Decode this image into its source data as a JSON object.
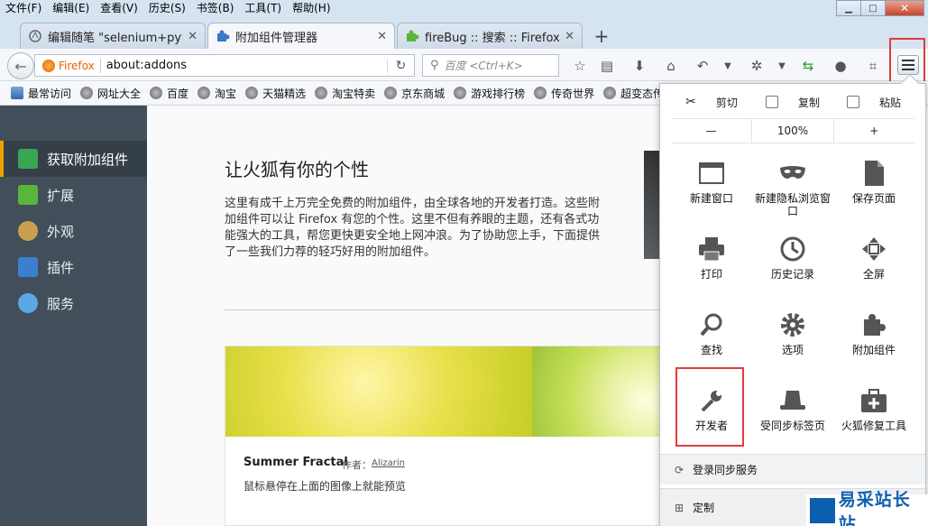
{
  "menubar": {
    "items": [
      "文件(F)",
      "编辑(E)",
      "查看(V)",
      "历史(S)",
      "书签(B)",
      "工具(T)",
      "帮助(H)"
    ]
  },
  "tabs": [
    {
      "label": "编辑随笔 \"selenium+pytho",
      "icon": "blog-icon"
    },
    {
      "label": "附加组件管理器",
      "icon": "puzzle-icon"
    },
    {
      "label": "fireBug :: 搜索 :: Firefox 附加",
      "icon": "puzzle-green-icon"
    }
  ],
  "newtab": "+",
  "navbar": {
    "identity": "Firefox",
    "url": "about:addons",
    "search_placeholder": "百度 <Ctrl+K>"
  },
  "bookmarks": [
    "最常访问",
    "网址大全",
    "百度",
    "淘宝",
    "天猫精选",
    "淘宝特卖",
    "京东商城",
    "游戏排行榜",
    "传奇世界",
    "超变态传"
  ],
  "sidebar": {
    "items": [
      {
        "label": "获取附加组件",
        "color": "#3aa655"
      },
      {
        "label": "扩展",
        "color": "#5ab63a"
      },
      {
        "label": "外观",
        "color": "#c8a050"
      },
      {
        "label": "插件",
        "color": "#3a7fd0"
      },
      {
        "label": "服务",
        "color": "#5aa9e6"
      }
    ]
  },
  "main": {
    "headline": "让火狐有你的个性",
    "description": "这里有成千上万完全免费的附加组件，由全球各地的开发者打造。这些附加组件可以让 Firefox 有您的个性。这里不但有养眼的主题，还有各式功能强大的工具，帮您更快更安全地上网冲浪。为了协助您上手，下面提供了一些我们力荐的轻巧好用的附加组件。",
    "card": {
      "title": "Summer Fractal",
      "by_label": "作者：",
      "author": "Alizarin",
      "subtitle": "鼠标悬停在上面的图像上就能预览"
    }
  },
  "panel": {
    "edit": {
      "cut": "剪切",
      "copy": "复制",
      "paste": "粘贴"
    },
    "zoom": {
      "minus": "—",
      "level": "100%",
      "plus": "+"
    },
    "items": [
      {
        "label": "新建窗口",
        "icon": "window-icon"
      },
      {
        "label": "新建隐私浏览窗口",
        "icon": "mask-icon"
      },
      {
        "label": "保存页面",
        "icon": "page-icon"
      },
      {
        "label": "打印",
        "icon": "printer-icon"
      },
      {
        "label": "历史记录",
        "icon": "clock-icon"
      },
      {
        "label": "全屏",
        "icon": "fullscreen-icon"
      },
      {
        "label": "查找",
        "icon": "magnifier-icon"
      },
      {
        "label": "选项",
        "icon": "gear-icon"
      },
      {
        "label": "附加组件",
        "icon": "puzzle-icon"
      },
      {
        "label": "开发者",
        "icon": "wrench-icon"
      },
      {
        "label": "受同步标签页",
        "icon": "hat-icon"
      },
      {
        "label": "火狐修复工具",
        "icon": "toolbox-icon"
      }
    ],
    "sync_label": "登录同步服务",
    "customize_label": "定制"
  },
  "watermark": "易采站长站"
}
